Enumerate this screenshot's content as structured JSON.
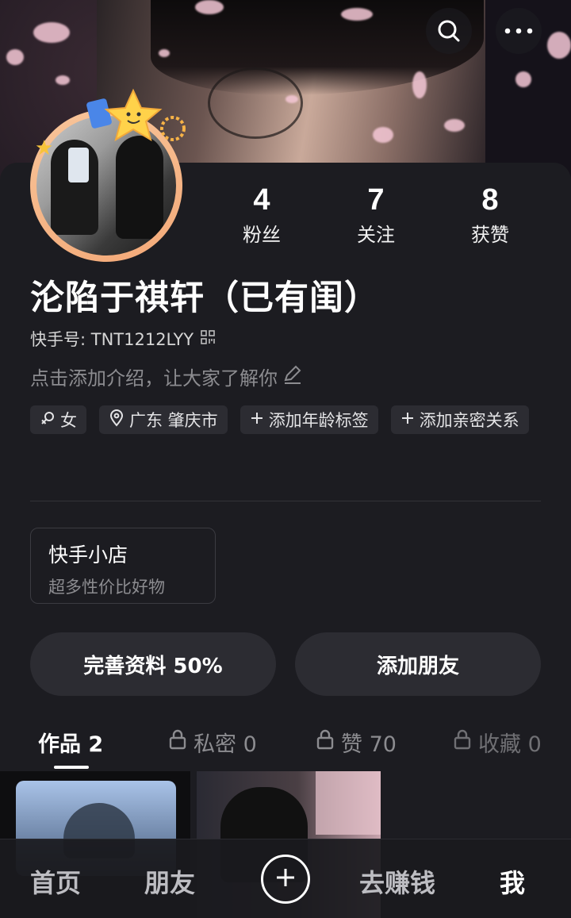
{
  "profile": {
    "name": "沦陷于祺轩（已有闺）",
    "kuaishou_id_label": "快手号: TNT1212LYY",
    "intro_placeholder": "点击添加介绍，让大家了解你"
  },
  "stats": [
    {
      "value": "4",
      "label": "粉丝"
    },
    {
      "value": "7",
      "label": "关注"
    },
    {
      "value": "8",
      "label": "获赞"
    }
  ],
  "tags": {
    "gender": "女",
    "location": "广东 肇庆市",
    "add_age": "添加年龄标签",
    "add_relation": "添加亲密关系"
  },
  "shop": {
    "title": "快手小店",
    "subtitle": "超多性价比好物"
  },
  "actions": {
    "complete_profile": "完善资料 50%",
    "add_friend": "添加朋友"
  },
  "tabs": [
    {
      "label": "作品 2"
    },
    {
      "label": "私密 0"
    },
    {
      "label": "赞 70"
    },
    {
      "label": "收藏 0"
    }
  ],
  "bottom_nav": {
    "home": "首页",
    "friends": "朋友",
    "earn": "去赚钱",
    "me": "我"
  },
  "icons": {
    "search": "search-icon",
    "more": "more-icon",
    "qr": "qr-code-icon",
    "edit": "pencil-icon",
    "gender": "female-icon",
    "location": "location-pin-icon",
    "plus": "plus-icon",
    "lock": "lock-icon"
  }
}
